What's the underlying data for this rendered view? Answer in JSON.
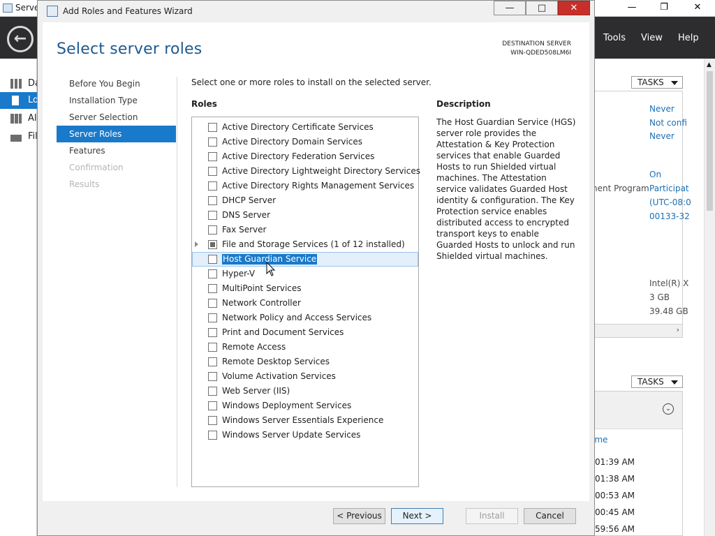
{
  "bg_window": {
    "title": "Serve",
    "menu": [
      "Tools",
      "View",
      "Help"
    ],
    "nav": [
      {
        "label": "Da",
        "icon": "dashboard-icon"
      },
      {
        "label": "Lo",
        "icon": "local-server-icon"
      },
      {
        "label": "Al",
        "icon": "all-servers-icon"
      },
      {
        "label": "Fil",
        "icon": "file-storage-icon"
      }
    ],
    "tasks_label": "TASKS",
    "props": [
      "Never",
      "Not confi",
      "Never",
      "On",
      "Participat",
      "(UTC-08:0",
      "00133-32"
    ],
    "prog_text": "nent Program",
    "hw": [
      "Intel(R) X",
      "3 GB",
      "39.48 GB"
    ],
    "events_col": "ime",
    "times": [
      ":01:39 AM",
      ":01:38 AM",
      ":00:53 AM",
      ":00:45 AM",
      ":59:56 AM"
    ]
  },
  "wizard": {
    "title": "Add Roles and Features Wizard",
    "page_title": "Select server roles",
    "dest_label": "DESTINATION SERVER",
    "dest_server": "WIN-QDED508LM6I",
    "steps": [
      {
        "label": "Before You Begin",
        "state": "normal"
      },
      {
        "label": "Installation Type",
        "state": "normal"
      },
      {
        "label": "Server Selection",
        "state": "normal"
      },
      {
        "label": "Server Roles",
        "state": "active"
      },
      {
        "label": "Features",
        "state": "normal"
      },
      {
        "label": "Confirmation",
        "state": "disabled"
      },
      {
        "label": "Results",
        "state": "disabled"
      }
    ],
    "intro": "Select one or more roles to install on the selected server.",
    "roles_heading": "Roles",
    "description_heading": "Description",
    "description": "The Host Guardian Service (HGS) server role provides the Attestation & Key Protection services that enable Guarded Hosts to run Shielded virtual machines. The Attestation service validates Guarded Host identity & configuration. The Key Protection service enables distributed access to encrypted transport keys to enable Guarded Hosts to unlock and run Shielded virtual machines.",
    "roles": [
      {
        "label": "Active Directory Certificate Services",
        "state": "unchecked"
      },
      {
        "label": "Active Directory Domain Services",
        "state": "unchecked"
      },
      {
        "label": "Active Directory Federation Services",
        "state": "unchecked"
      },
      {
        "label": "Active Directory Lightweight Directory Services",
        "state": "unchecked"
      },
      {
        "label": "Active Directory Rights Management Services",
        "state": "unchecked"
      },
      {
        "label": "DHCP Server",
        "state": "unchecked"
      },
      {
        "label": "DNS Server",
        "state": "unchecked"
      },
      {
        "label": "Fax Server",
        "state": "unchecked"
      },
      {
        "label": "File and Storage Services (1 of 12 installed)",
        "state": "partial",
        "expandable": true
      },
      {
        "label": "Host Guardian Service",
        "state": "unchecked",
        "selected": true
      },
      {
        "label": "Hyper-V",
        "state": "unchecked"
      },
      {
        "label": "MultiPoint Services",
        "state": "unchecked"
      },
      {
        "label": "Network Controller",
        "state": "unchecked"
      },
      {
        "label": "Network Policy and Access Services",
        "state": "unchecked"
      },
      {
        "label": "Print and Document Services",
        "state": "unchecked"
      },
      {
        "label": "Remote Access",
        "state": "unchecked"
      },
      {
        "label": "Remote Desktop Services",
        "state": "unchecked"
      },
      {
        "label": "Volume Activation Services",
        "state": "unchecked"
      },
      {
        "label": "Web Server (IIS)",
        "state": "unchecked"
      },
      {
        "label": "Windows Deployment Services",
        "state": "unchecked"
      },
      {
        "label": "Windows Server Essentials Experience",
        "state": "unchecked"
      },
      {
        "label": "Windows Server Update Services",
        "state": "unchecked"
      }
    ],
    "buttons": {
      "previous": "< Previous",
      "next": "Next >",
      "install": "Install",
      "cancel": "Cancel"
    }
  },
  "colors": {
    "accent": "#1979ca",
    "title_blue": "#1e5a8f",
    "close_red": "#c7302a"
  }
}
